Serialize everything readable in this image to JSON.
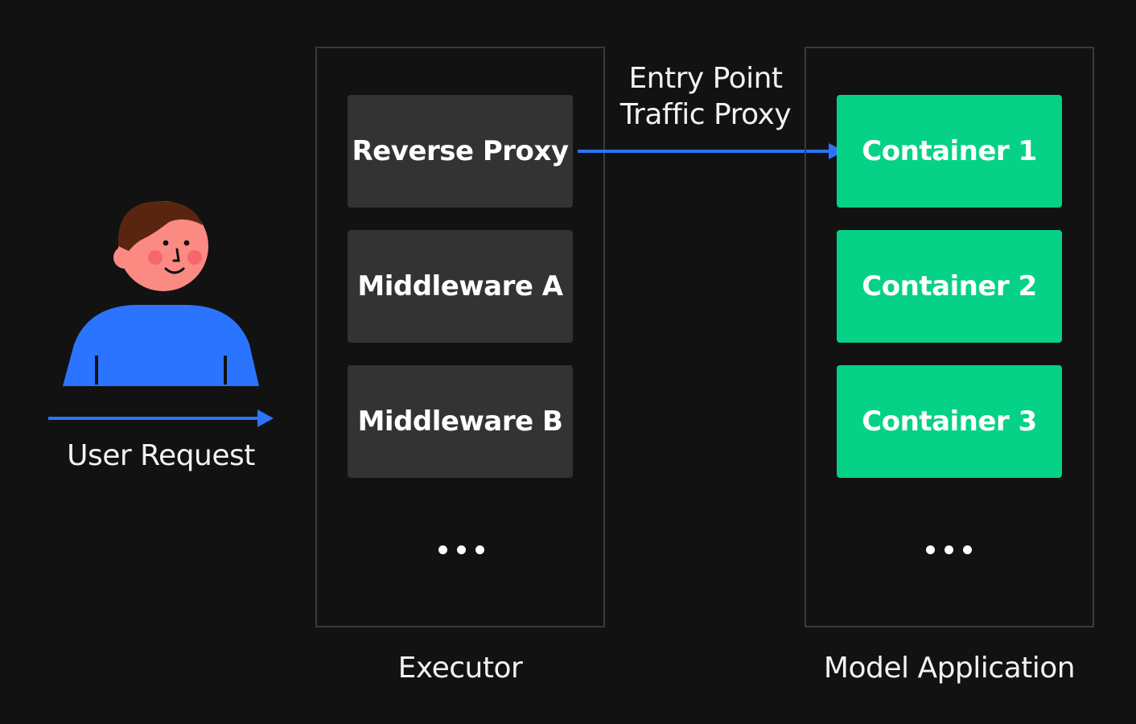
{
  "colors": {
    "background": "#121212",
    "panel_border": "#3a3a3a",
    "dark_box": "#333333",
    "container_box": "#05d286",
    "arrow": "#2b74ff",
    "person_shirt": "#2b74ff",
    "person_skin": "#fb8a82",
    "person_hair": "#5a2510"
  },
  "user": {
    "label": "User Request",
    "icon": "person-icon"
  },
  "executor": {
    "label": "Executor",
    "items": [
      "Reverse Proxy",
      "Middleware A",
      "Middleware B"
    ],
    "more_icon": "ellipsis-icon"
  },
  "connector": {
    "line1": "Entry Point",
    "line2": "Traffic Proxy"
  },
  "model_application": {
    "label": "Model Application",
    "items": [
      "Container 1",
      "Container 2",
      "Container 3"
    ],
    "more_icon": "ellipsis-icon"
  }
}
